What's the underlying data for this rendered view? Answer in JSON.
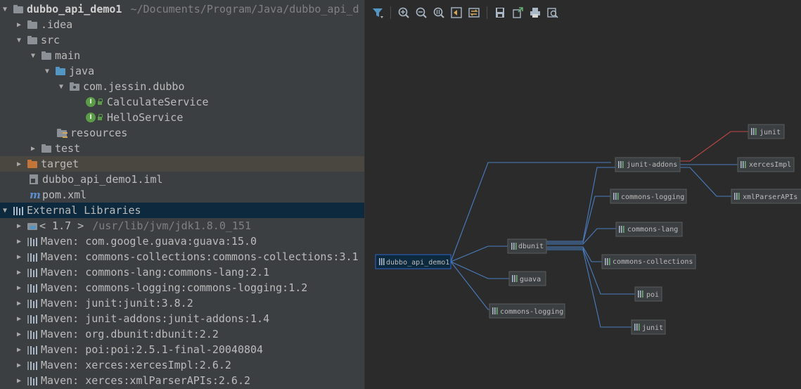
{
  "tree": {
    "root": {
      "name": "dubbo_api_demo1",
      "path": "~/Documents/Program/Java/dubbo_api_d"
    },
    "items": [
      {
        "label": ".idea"
      },
      {
        "label": "src"
      },
      {
        "label": "main"
      },
      {
        "label": "java"
      },
      {
        "label": "com.jessin.dubbo"
      },
      {
        "label": "CalculateService",
        "badge": "I"
      },
      {
        "label": "HelloService",
        "badge": "I"
      },
      {
        "label": "resources"
      },
      {
        "label": "test"
      },
      {
        "label": "target"
      },
      {
        "label": "dubbo_api_demo1.iml"
      },
      {
        "label": "pom.xml",
        "icon": "m"
      }
    ],
    "external": {
      "label": "External Libraries",
      "jdk": {
        "label": "< 1.7 >",
        "hint": "/usr/lib/jvm/jdk1.8.0_151"
      },
      "libs": [
        "Maven: com.google.guava:guava:15.0",
        "Maven: commons-collections:commons-collections:3.1",
        "Maven: commons-lang:commons-lang:2.1",
        "Maven: commons-logging:commons-logging:1.2",
        "Maven: junit:junit:3.8.2",
        "Maven: junit-addons:junit-addons:1.4",
        "Maven: org.dbunit:dbunit:2.2",
        "Maven: poi:poi:2.5.1-final-20040804",
        "Maven: xerces:xercesImpl:2.6.2",
        "Maven: xerces:xmlParserAPIs:2.6.2"
      ]
    }
  },
  "diagram": {
    "nodes": {
      "root": "dubbo_api_demo1",
      "dbunit": "dbunit",
      "guava": "guava",
      "commons_logging_a": "commons-logging",
      "junit_addons": "junit-addons",
      "commons_logging_b": "commons-logging",
      "commons_lang": "commons-lang",
      "commons_collections": "commons-collections",
      "poi": "poi",
      "junit_b": "junit",
      "junit_a": "junit",
      "xercesImpl": "xercesImpl",
      "xmlParserAPIs": "xmlParserAPIs"
    }
  },
  "toolbar": {
    "icons": [
      "filter-icon",
      "zoom-in-icon",
      "zoom-out-icon",
      "actual-size-icon",
      "fit-content-icon",
      "layout-icon",
      "save-icon",
      "export-icon",
      "print-icon",
      "print-preview-icon"
    ]
  },
  "colors": {
    "edge": "#4a7ec0",
    "conflict_edge": "#c24747",
    "selection": "#0d293e"
  }
}
